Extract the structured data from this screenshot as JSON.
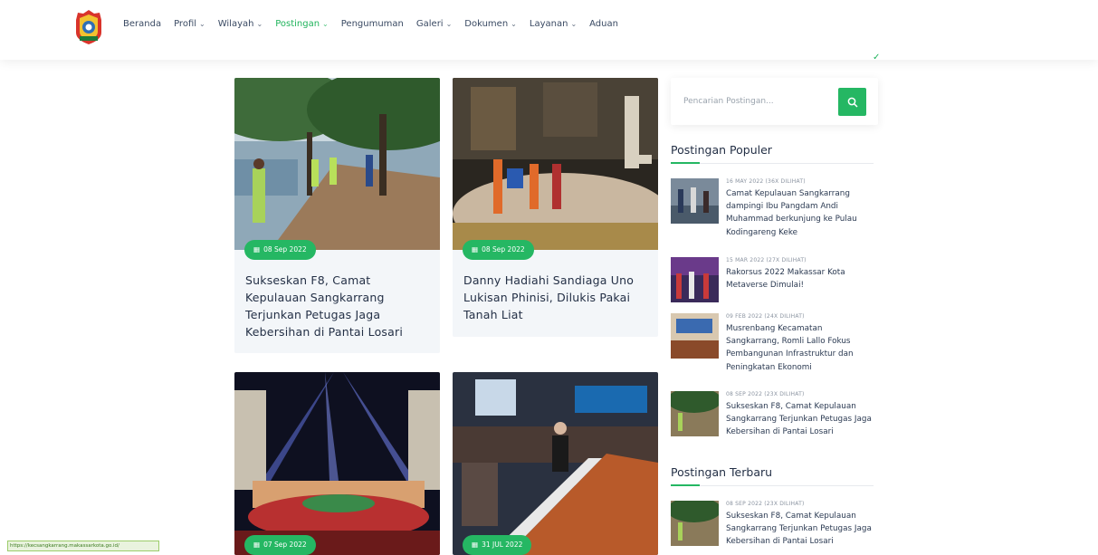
{
  "nav": {
    "items": [
      {
        "label": "Beranda",
        "dropdown": false
      },
      {
        "label": "Profil",
        "dropdown": true
      },
      {
        "label": "Wilayah",
        "dropdown": true
      },
      {
        "label": "Postingan",
        "dropdown": true,
        "active": true
      },
      {
        "label": "Pengumuman",
        "dropdown": false
      },
      {
        "label": "Galeri",
        "dropdown": true
      },
      {
        "label": "Dokumen",
        "dropdown": true
      },
      {
        "label": "Layanan",
        "dropdown": true
      },
      {
        "label": "Aduan",
        "dropdown": false
      }
    ],
    "chevron": "⌄"
  },
  "colors": {
    "accent": "#25b763",
    "active_nav": "#1fb35b",
    "title": "#243046"
  },
  "cards": [
    {
      "date": "08 Sep 2022",
      "title": "Sukseskan F8, Camat Kepulauan Sangkarrang Terjunkan Petugas Jaga Kebersihan di Pantai Losari"
    },
    {
      "date": "08 Sep 2022",
      "title": "Danny Hadiahi Sandiaga Uno Lukisan Phinisi, Dilukis Pakai Tanah Liat"
    },
    {
      "date": "07 Sep 2022",
      "title": ""
    },
    {
      "date": "31 JUL 2022",
      "title": ""
    }
  ],
  "search": {
    "placeholder": "Pencarian Postingan..."
  },
  "popular": {
    "title": "Postingan Populer",
    "posts": [
      {
        "meta": "16 MAY 2022 (36X DILIHAT)",
        "title": "Camat Kepulauan Sangkarrang dampingi Ibu Pangdam Andi Muhammad berkunjung ke Pulau Kodingareng Keke"
      },
      {
        "meta": "15 MAR 2022 (27X DILIHAT)",
        "title": "Rakorsus 2022 Makassar Kota Metaverse Dimulai!"
      },
      {
        "meta": "09 FEB 2022 (24X DILIHAT)",
        "title": "Musrenbang Kecamatan Sangkarrang, Romli Lallo Fokus Pembangunan Infrastruktur dan Peningkatan Ekonomi"
      },
      {
        "meta": "08 SEP 2022 (23X DILIHAT)",
        "title": "Sukseskan F8, Camat Kepulauan Sangkarrang Terjunkan Petugas Jaga Kebersihan di Pantai Losari"
      }
    ]
  },
  "latest": {
    "title": "Postingan Terbaru",
    "posts": [
      {
        "meta": "08 SEP 2022 (23X DILIHAT)",
        "title": "Sukseskan F8, Camat Kepulauan Sangkarrang Terjunkan Petugas Jaga Kebersihan di Pantai Losari"
      }
    ]
  },
  "status_url": "https://kecsangkarrang.makassarkota.go.id/"
}
